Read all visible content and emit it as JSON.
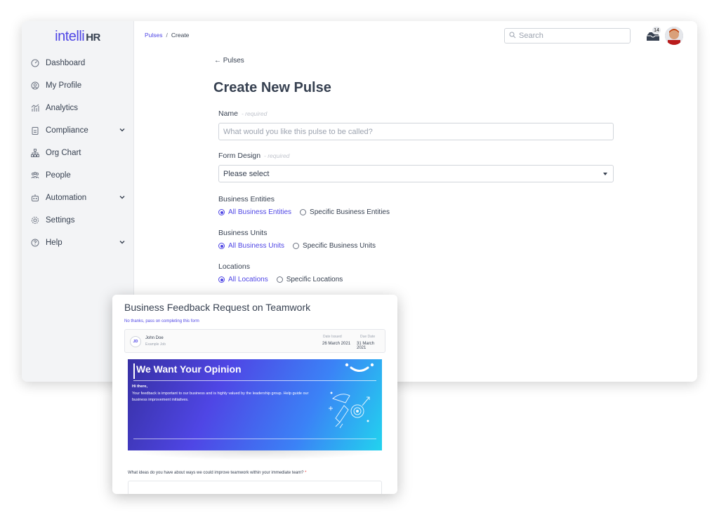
{
  "sidebar": {
    "logo_main": "intelli",
    "logo_suffix": "HR",
    "items": [
      {
        "label": "Dashboard",
        "icon": "dashboard-gauge-icon"
      },
      {
        "label": "My Profile",
        "icon": "profile-icon"
      },
      {
        "label": "Analytics",
        "icon": "analytics-icon"
      },
      {
        "label": "Compliance",
        "icon": "clipboard-icon",
        "expandable": true
      },
      {
        "label": "Org Chart",
        "icon": "org-chart-icon"
      },
      {
        "label": "People",
        "icon": "people-icon"
      },
      {
        "label": "Automation",
        "icon": "robot-icon",
        "expandable": true
      },
      {
        "label": "Settings",
        "icon": "gear-icon"
      },
      {
        "label": "Help",
        "icon": "help-icon",
        "expandable": true
      }
    ]
  },
  "header": {
    "breadcrumb": {
      "parent": "Pulses",
      "separator": "/",
      "current": "Create"
    },
    "search_placeholder": "Search",
    "notification_count": "14"
  },
  "main": {
    "back_label": "Pulses",
    "title": "Create New Pulse",
    "name": {
      "label": "Name",
      "hint": "- required",
      "placeholder": "What would you like this pulse to be called?"
    },
    "form_design": {
      "label": "Form Design",
      "hint": "- required",
      "value": "Please select"
    },
    "business_entities": {
      "label": "Business Entities",
      "options": [
        "All Business Entities",
        "Specific Business Entities"
      ],
      "selected": 0
    },
    "business_units": {
      "label": "Business Units",
      "options": [
        "All Business Units",
        "Specific Business Units"
      ],
      "selected": 0
    },
    "locations": {
      "label": "Locations",
      "options": [
        "All Locations",
        "Specific Locations"
      ],
      "selected": 0
    }
  },
  "preview": {
    "title": "Business Feedback Request on Teamwork",
    "skip_link": "No thanks, pass on completing this form",
    "employee": {
      "initials": "JD",
      "name": "John Doe",
      "job": "Example Job"
    },
    "date_issued_label": "Date Issued",
    "date_issued": "26 March 2021",
    "due_date_label": "Due Date",
    "due_date": "31 March 2021",
    "banner": {
      "heading": "We Want Your Opinion",
      "greeting": "Hi there,",
      "message": "Your feedback is important to our business and is highly valued by the leadership group. Help guide our business improvement initiatives."
    },
    "question": "What ideas do you have about ways we could improve teamwork within your immediate team?",
    "required_mark": "*"
  },
  "colors": {
    "accent": "#4f46e5",
    "text": "#374151",
    "sidebar_bg": "#f3f4f6",
    "required": "#ef4444"
  }
}
